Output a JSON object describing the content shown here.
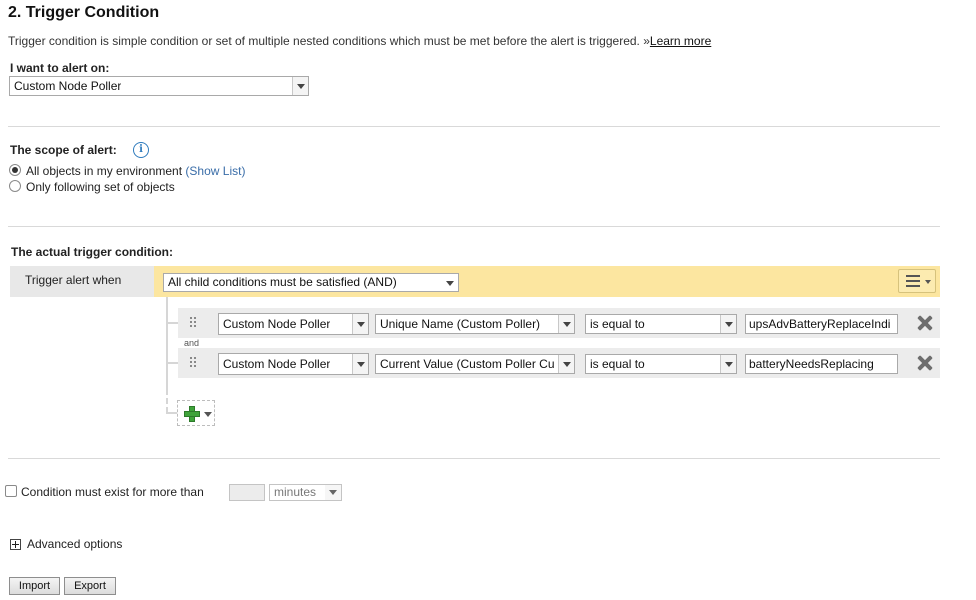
{
  "section": {
    "title": "2. Trigger Condition",
    "description": "Trigger condition is simple condition or set of multiple nested conditions which must be met before the alert is triggered.",
    "learn_more_prefix": "»",
    "learn_more": "Learn more"
  },
  "alert_on": {
    "label": "I want to alert on:",
    "selected": "Custom Node Poller"
  },
  "scope": {
    "label": "The scope of alert:",
    "options": [
      {
        "label": "All objects in my environment",
        "link": "(Show List)",
        "checked": true
      },
      {
        "label": "Only following set of objects",
        "checked": false
      }
    ]
  },
  "trigger": {
    "label": "The actual trigger condition:",
    "when_label": "Trigger alert when",
    "group_selected": "All child conditions must be satisfied (AND)",
    "connector": "and",
    "conditions": [
      {
        "object": "Custom Node Poller",
        "field": "Unique Name (Custom Poller)",
        "operator": "is equal to",
        "value": "upsAdvBatteryReplaceIndi"
      },
      {
        "object": "Custom Node Poller",
        "field": "Current Value (Custom Poller Cu",
        "operator": "is equal to",
        "value": "batteryNeedsReplacing"
      }
    ]
  },
  "duration": {
    "label": "Condition must exist for more than",
    "value": "",
    "unit": "minutes",
    "checked": false
  },
  "advanced": {
    "label": "Advanced options"
  },
  "buttons": {
    "import": "Import",
    "export": "Export"
  },
  "colors": {
    "accent_yellow": "#fce6a0",
    "info_blue": "#2f7bbd",
    "link_blue": "#3a6da8",
    "add_green": "#3fa33a"
  }
}
